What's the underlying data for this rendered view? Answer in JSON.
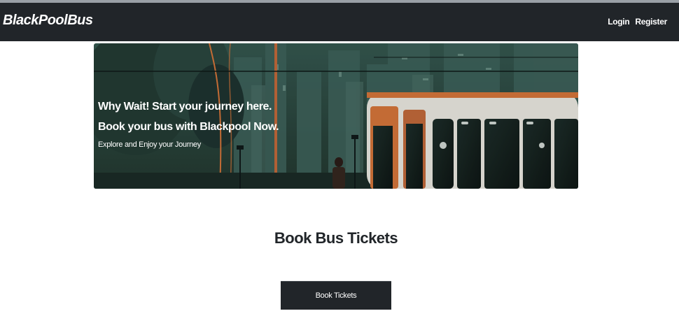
{
  "navbar": {
    "brand": "BlackPoolBus",
    "links": [
      {
        "label": "Login"
      },
      {
        "label": "Register"
      }
    ]
  },
  "hero": {
    "line1": "Why Wait! Start your journey here.",
    "line2": "Book your bus with Blackpool Now.",
    "subtitle": "Explore and Enjoy your Journey"
  },
  "section": {
    "title": "Book Bus Tickets",
    "button_label": "Book Tickets"
  },
  "colors": {
    "navbar_bg": "#212529",
    "hero_bg": "#2e4a44",
    "bus_accent": "#d4753a",
    "button_bg": "#212529"
  }
}
